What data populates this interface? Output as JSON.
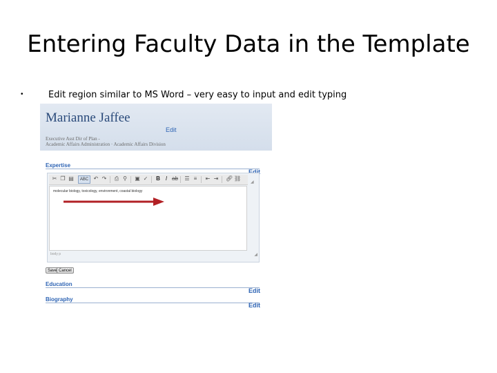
{
  "slide": {
    "title": "Entering Faculty Data in the Template",
    "bullet": "Edit region similar to MS Word – very easy to input and edit typing"
  },
  "profile": {
    "name": "Marianne  Jaffee",
    "edit_label": "Edit",
    "position_line": "Executive Asst Dir of Plan -",
    "department_line": "Academic Affairs Administration · Academic Affairs Division"
  },
  "sections": {
    "expertise": {
      "label": "Expertise",
      "edit": "Edit"
    },
    "education": {
      "label": "Education",
      "edit": "Edit"
    },
    "biography": {
      "label": "Biography",
      "edit": "Edit"
    }
  },
  "editor": {
    "content": "molecular biology, toxicology, environment, coastal biology",
    "status_path": "body   p",
    "style_selector": "ABC",
    "save_label": "Save",
    "cancel_label": "Cancel"
  },
  "icons": {
    "arrow_color": "#b22025",
    "accent_color": "#2e64b4"
  }
}
